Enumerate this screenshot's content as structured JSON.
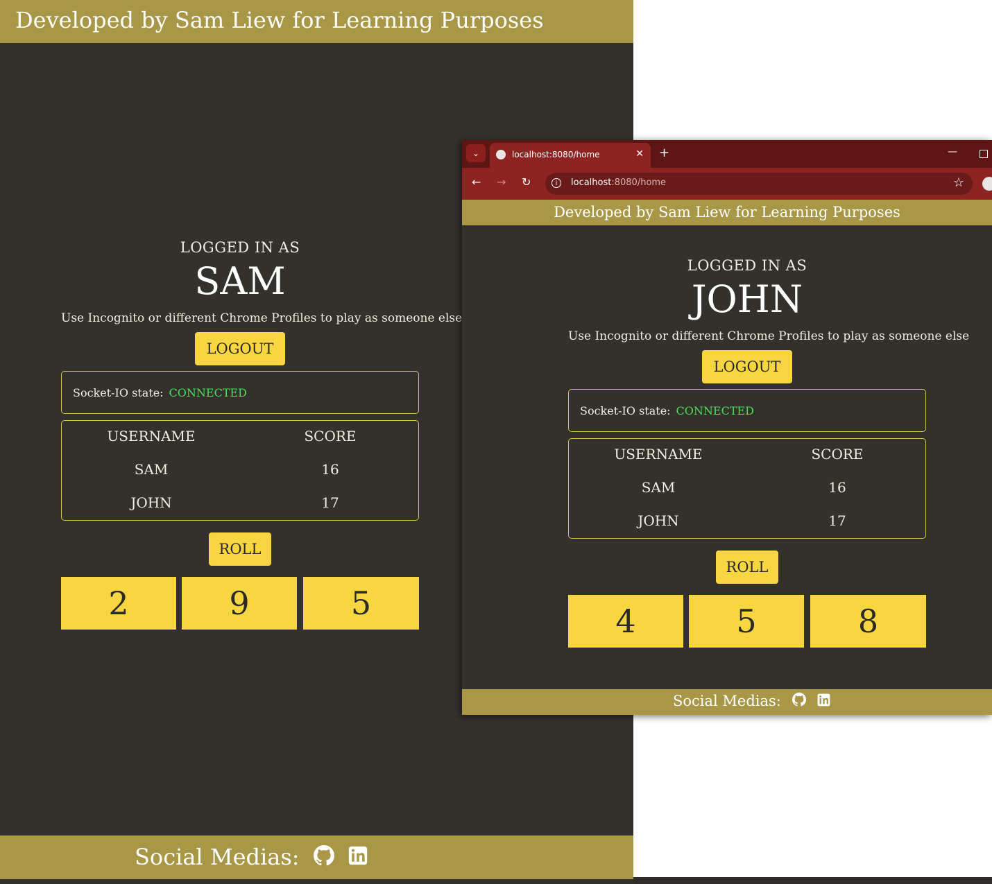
{
  "app": {
    "header_text": "Developed by Sam Liew for Learning Purposes",
    "footer_text": "Social Medias:",
    "footer_icons": [
      "github-icon",
      "linkedin-icon"
    ],
    "colors": {
      "gold_bar": "#a89747",
      "background": "#33312c",
      "button": "#f8d641",
      "connected": "#4ddc5b",
      "browser_chrome": "#8d2421"
    }
  },
  "sam_window": {
    "logged_in_label": "LOGGED IN AS",
    "username": "SAM",
    "hint": "Use Incognito or different Chrome Profiles to play as someone else",
    "logout_label": "LOGOUT",
    "socket_label": "Socket-IO state:",
    "socket_state": "CONNECTED",
    "scores": {
      "headers": [
        "USERNAME",
        "SCORE"
      ],
      "rows": [
        {
          "name": "SAM",
          "score": "16"
        },
        {
          "name": "JOHN",
          "score": "17"
        }
      ]
    },
    "roll_label": "ROLL",
    "dice": [
      "2",
      "9",
      "5"
    ]
  },
  "browser": {
    "tab_title": "localhost:8080/home",
    "url_host": "localhost",
    "url_path": ":8080/home",
    "new_tab": "+",
    "close_tab": "✕"
  },
  "john_window": {
    "logged_in_label": "LOGGED IN AS",
    "username": "JOHN",
    "hint": "Use Incognito or different Chrome Profiles to play as someone else",
    "logout_label": "LOGOUT",
    "socket_label": "Socket-IO state:",
    "socket_state": "CONNECTED",
    "scores": {
      "headers": [
        "USERNAME",
        "SCORE"
      ],
      "rows": [
        {
          "name": "SAM",
          "score": "16"
        },
        {
          "name": "JOHN",
          "score": "17"
        }
      ]
    },
    "roll_label": "ROLL",
    "dice": [
      "4",
      "5",
      "8"
    ]
  }
}
